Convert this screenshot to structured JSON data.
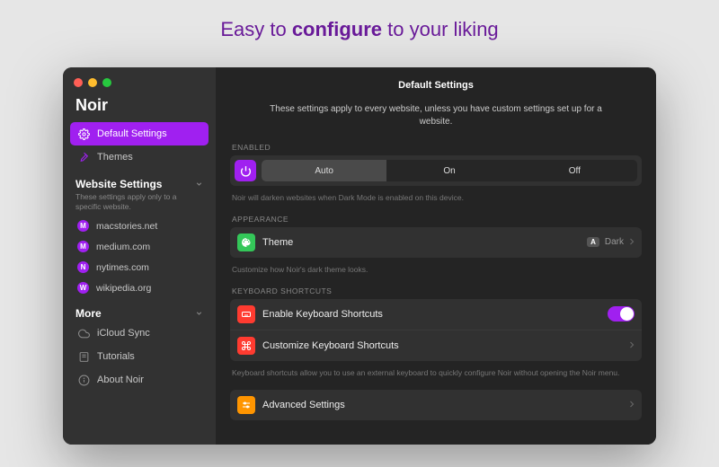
{
  "headline_pre": "Easy to ",
  "headline_bold": "configure",
  "headline_post": " to your liking",
  "app_name": "Noir",
  "nav": {
    "default_settings": "Default Settings",
    "themes": "Themes"
  },
  "website_settings": {
    "heading": "Website Settings",
    "desc": "These settings apply only to a specific website.",
    "sites": [
      "macstories.net",
      "medium.com",
      "nytimes.com",
      "wikipedia.org"
    ]
  },
  "more": {
    "heading": "More",
    "icloud": "iCloud Sync",
    "tutorials": "Tutorials",
    "about": "About Noir"
  },
  "main": {
    "title": "Default Settings",
    "desc": "These settings apply to every website, unless you have custom settings set up for a website.",
    "enabled_label": "ENABLED",
    "seg": {
      "auto": "Auto",
      "on": "On",
      "off": "Off"
    },
    "enabled_hint": "Noir will darken websites when Dark Mode is enabled on this device.",
    "appearance_label": "APPEARANCE",
    "theme": {
      "label": "Theme",
      "badge": "A",
      "value": "Dark"
    },
    "appearance_hint": "Customize how Noir's dark theme looks.",
    "kbd_label": "KEYBOARD SHORTCUTS",
    "kbd_enable": "Enable Keyboard Shortcuts",
    "kbd_custom": "Customize Keyboard Shortcuts",
    "kbd_hint": "Keyboard shortcuts allow you to use an external keyboard to quickly configure Noir without opening the Noir menu.",
    "advanced": "Advanced Settings"
  }
}
